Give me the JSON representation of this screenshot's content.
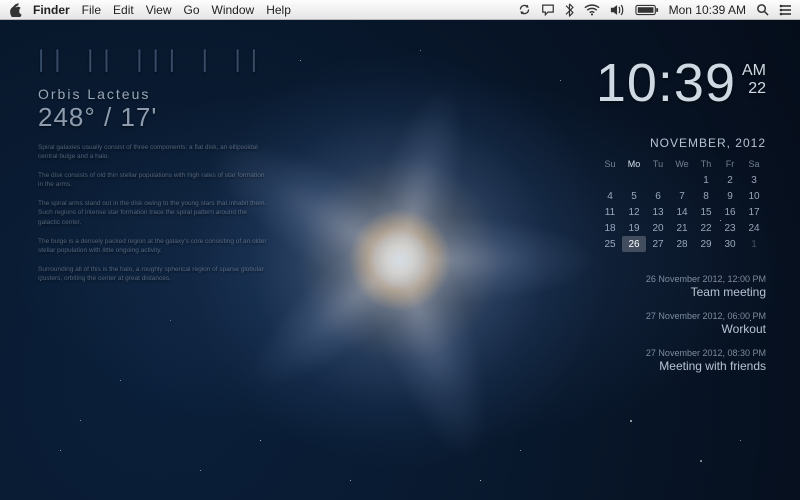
{
  "menubar": {
    "app": "Finder",
    "items": [
      "File",
      "Edit",
      "View",
      "Go",
      "Window",
      "Help"
    ],
    "clock": "Mon 10:39 AM"
  },
  "info": {
    "glyph_row": "|| ||  |||  | ||",
    "title": "Orbis  Lacteus",
    "big": "248°  /  17'",
    "paragraphs": [
      "Spiral galaxies usually consist of three components: a flat disk, an ellipsoidal central bulge and a halo.",
      "The disk consists of old thin stellar populations with high rates of star formation in the arms.",
      "The spiral arms stand out in the disk owing to the young stars that inhabit them. Such regions of intense star formation trace the spiral pattern around the galactic center.",
      "The bulge is a densely packed region at the galaxy's core consisting of an older stellar population with little ongoing activity.",
      "Surrounding all of this is the halo, a roughly spherical region of sparse globular clusters, orbiting the center at great distances."
    ]
  },
  "clock": {
    "hm": "10:39",
    "ampm": "AM",
    "sec": "22"
  },
  "calendar": {
    "month_label": "NOVEMBER, 2012",
    "weekdays": [
      "Su",
      "Mo",
      "Tu",
      "We",
      "Th",
      "Fr",
      "Sa"
    ],
    "today_col": 1,
    "weeks": [
      [
        {
          "d": "",
          "dim": true
        },
        {
          "d": "",
          "dim": true
        },
        {
          "d": "",
          "dim": true
        },
        {
          "d": "",
          "dim": true
        },
        {
          "d": "1"
        },
        {
          "d": "2"
        },
        {
          "d": "3"
        }
      ],
      [
        {
          "d": "4"
        },
        {
          "d": "5"
        },
        {
          "d": "6"
        },
        {
          "d": "7"
        },
        {
          "d": "8"
        },
        {
          "d": "9"
        },
        {
          "d": "10"
        }
      ],
      [
        {
          "d": "11"
        },
        {
          "d": "12"
        },
        {
          "d": "13"
        },
        {
          "d": "14"
        },
        {
          "d": "15"
        },
        {
          "d": "16"
        },
        {
          "d": "17"
        }
      ],
      [
        {
          "d": "18"
        },
        {
          "d": "19"
        },
        {
          "d": "20"
        },
        {
          "d": "21"
        },
        {
          "d": "22"
        },
        {
          "d": "23"
        },
        {
          "d": "24"
        }
      ],
      [
        {
          "d": "25"
        },
        {
          "d": "26",
          "today": true
        },
        {
          "d": "27"
        },
        {
          "d": "28"
        },
        {
          "d": "29"
        },
        {
          "d": "30"
        },
        {
          "d": "1",
          "dim": true
        }
      ]
    ]
  },
  "events": [
    {
      "when": "26 November 2012, 12:00 PM",
      "title": "Team meeting"
    },
    {
      "when": "27 November 2012, 06:00 PM",
      "title": "Workout"
    },
    {
      "when": "27 November 2012, 08:30 PM",
      "title": "Meeting with friends"
    }
  ]
}
